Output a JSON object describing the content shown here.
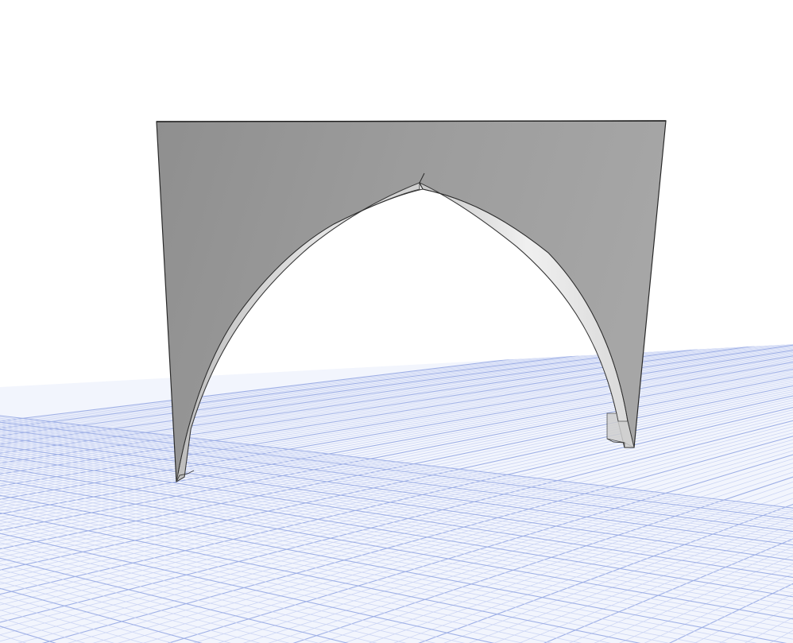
{
  "viewport": {
    "background_color": "#ffffff",
    "ground_plane": {
      "fill_color": "#f2f5fd",
      "minor_grid_color": "#cdd6f4",
      "major_grid_color": "#9fb0e6"
    },
    "model": {
      "name": "gothic-pointed-arch-wall",
      "face_color": "#9a9a9a",
      "edge_color": "#2a2a2a",
      "intrados_color": "#d6d6d6",
      "intrados_highlight_color": "#f2f2f2"
    }
  }
}
